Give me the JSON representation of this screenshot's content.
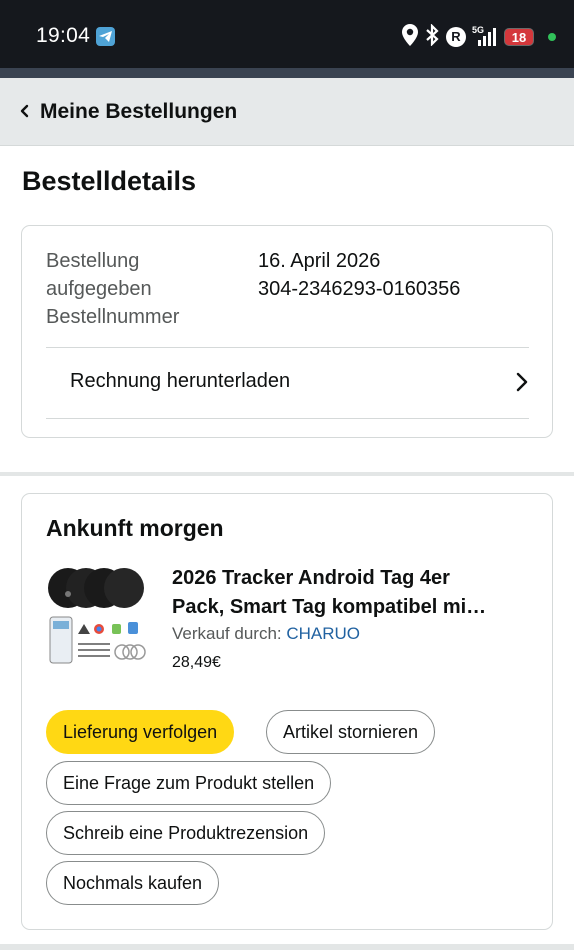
{
  "status_bar": {
    "time": "19:04",
    "battery": "18",
    "network": "5G",
    "icons": [
      "telegram-icon",
      "location-icon",
      "bluetooth-icon",
      "r-icon",
      "signal-icon",
      "battery-icon"
    ]
  },
  "nav": {
    "back_icon": "chevron-left-icon",
    "title": "Meine Bestellungen"
  },
  "page": {
    "title": "Bestelldetails"
  },
  "order_info": {
    "label_line1": "Bestellung",
    "label_line2": "aufgegeben",
    "label_line3": "Bestellnummer",
    "date": "16. April 2026",
    "order_number": "304-2346293-0160356",
    "invoice_label": "Rechnung herunterladen",
    "invoice_icon": "chevron-right-icon"
  },
  "shipment": {
    "heading": "Ankunft morgen",
    "product": {
      "title_line1": "2026 Tracker Android Tag 4er",
      "title_line2": "Pack, Smart Tag kompatibel mi…",
      "seller_prefix": "Verkauf durch: ",
      "seller_name": "CHARUO",
      "price": "28,49€"
    },
    "buttons": {
      "track": "Lieferung verfolgen",
      "cancel": "Artikel stornieren",
      "question": "Eine Frage zum Produkt stellen",
      "review": "Schreib eine Produktrezension",
      "buy_again": "Nochmals kaufen"
    }
  },
  "colors": {
    "status_bar_bg": "#15181d",
    "nav_bg": "#e6e9ea",
    "primary_button": "#ffd814",
    "seller_link": "#2162a1",
    "battery_bg": "#d4373b"
  }
}
